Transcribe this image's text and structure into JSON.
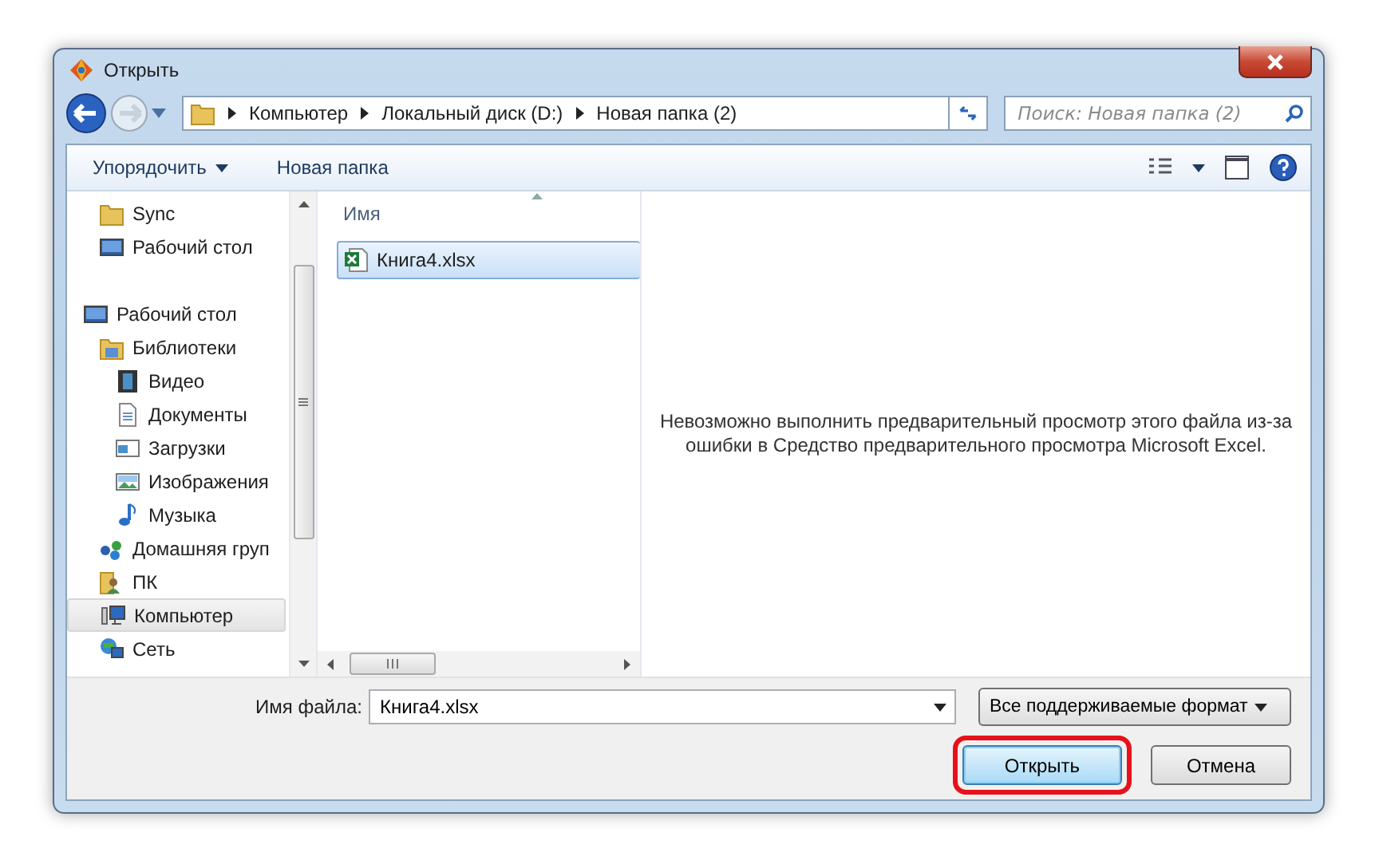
{
  "window": {
    "title": "Открыть"
  },
  "address": {
    "crumbs": [
      "Компьютер",
      "Локальный диск (D:)",
      "Новая папка (2)"
    ]
  },
  "search": {
    "placeholder": "Поиск: Новая папка (2)"
  },
  "toolbar": {
    "organize": "Упорядочить",
    "new_folder": "Новая папка"
  },
  "sidebar": {
    "favorites": [
      {
        "label": "Sync",
        "kind": "folder",
        "selected": false
      },
      {
        "label": "Рабочий стол",
        "kind": "desktop",
        "selected": false
      }
    ],
    "tree": [
      {
        "label": "Рабочий стол",
        "kind": "desktop",
        "selected": false,
        "children": [
          {
            "label": "Библиотеки",
            "kind": "library",
            "selected": false,
            "children": [
              {
                "label": "Видео",
                "kind": "video",
                "selected": false
              },
              {
                "label": "Документы",
                "kind": "docs",
                "selected": false
              },
              {
                "label": "Загрузки",
                "kind": "downloads",
                "selected": false
              },
              {
                "label": "Изображения",
                "kind": "images",
                "selected": false
              },
              {
                "label": "Музыка",
                "kind": "music",
                "selected": false
              }
            ]
          },
          {
            "label": "Домашняя груп",
            "kind": "homegroup",
            "selected": false
          },
          {
            "label": "ПК",
            "kind": "user",
            "selected": false
          },
          {
            "label": "Компьютер",
            "kind": "computer",
            "selected": true
          },
          {
            "label": "Сеть",
            "kind": "network",
            "selected": false
          }
        ]
      }
    ]
  },
  "file_list": {
    "column": "Имя",
    "files": [
      {
        "name": "Книга4.xlsx",
        "selected": true
      }
    ]
  },
  "preview": {
    "message": "Невозможно выполнить предварительный просмотр этого файла из-за ошибки в Средство предварительного просмотра Microsoft Excel."
  },
  "footer": {
    "filename_label": "Имя файла:",
    "filename": "Книга4.xlsx",
    "filter": "Все поддерживаемые формат",
    "buttons": [
      {
        "label": "Открыть",
        "kind": "primary",
        "highlighted": true
      },
      {
        "label": "Отмена",
        "kind": "normal",
        "highlighted": false
      }
    ]
  }
}
